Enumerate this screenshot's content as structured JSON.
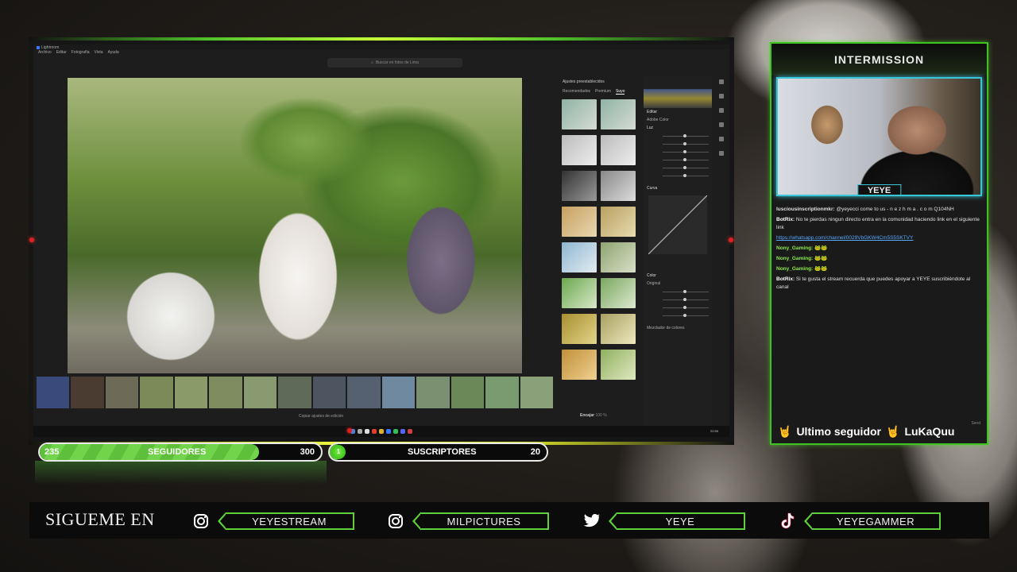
{
  "overlay": {
    "intermission_label": "INTERMISSION",
    "cam_name": "YEYE"
  },
  "app": {
    "title": "Lightroom",
    "menu": [
      "Archivo",
      "Editar",
      "Fotografía",
      "Vista",
      "Ayuda"
    ],
    "search_placeholder": "Buscar en fotos de Lima",
    "presets_title": "Ajustes preestablecidos",
    "preset_tabs": [
      "Recomendados",
      "Premium",
      "Suyo"
    ],
    "edit_title": "Editar",
    "profile_label": "Adobe Color",
    "light_section": "Luz",
    "curve_section": "Curva",
    "color_section": "Color",
    "wb_label": "Original",
    "mixer_label": "Mezclador de colores",
    "bottom_label": "Copiar ajustes de edición",
    "zoom_label": "Encajar",
    "zoom_value": "100 %",
    "clock": "22:55"
  },
  "chat": [
    {
      "user": "lusciousinscriptionmkr:",
      "text": "@yeyecci come to us - n e z h m a . c o m Q104NH",
      "kind": "normal"
    },
    {
      "user": "BotRix:",
      "text": "No te pierdas ningun directo entra en la comunidad haciendo link en el siguiente link",
      "kind": "bot"
    },
    {
      "user": "",
      "text": "https://whatsapp.com/channel/0029VbGKW4Cm5S5SKTVY",
      "kind": "link"
    },
    {
      "user": "Nony_Gaming:",
      "text": "🐸🐸",
      "kind": "nony"
    },
    {
      "user": "Nony_Gaming:",
      "text": "🐸🐸",
      "kind": "nony"
    },
    {
      "user": "Nony_Gaming:",
      "text": "🐸🐸",
      "kind": "nony"
    },
    {
      "user": "BotRix:",
      "text": "Si te gusta el stream recuerda que puedes apoyar a YEYE suscribiéndote al canal",
      "kind": "bot"
    }
  ],
  "follower": {
    "label": "Ultimo seguidor",
    "name": "LuKaQuu",
    "send": "Send"
  },
  "goals": {
    "followers": {
      "label": "SEGUIDORES",
      "current": "235",
      "target": "300",
      "progress": 0.78
    },
    "subs": {
      "label": "SUSCRIPTORES",
      "current": "1",
      "target": "20",
      "progress": 0.05
    }
  },
  "socials": {
    "title": "SIGUEME EN",
    "items": [
      {
        "icon": "instagram-icon",
        "handle": "YEYESTREAM"
      },
      {
        "icon": "instagram-icon",
        "handle": "MILPICTURES"
      },
      {
        "icon": "twitter-icon",
        "handle": "YEYE"
      },
      {
        "icon": "tiktok-icon",
        "handle": "YEYEGAMMER"
      }
    ]
  },
  "colors": {
    "accent_green": "#5fd03a",
    "cam_border": "#39c6d6",
    "link_blue": "#57a8ff"
  }
}
